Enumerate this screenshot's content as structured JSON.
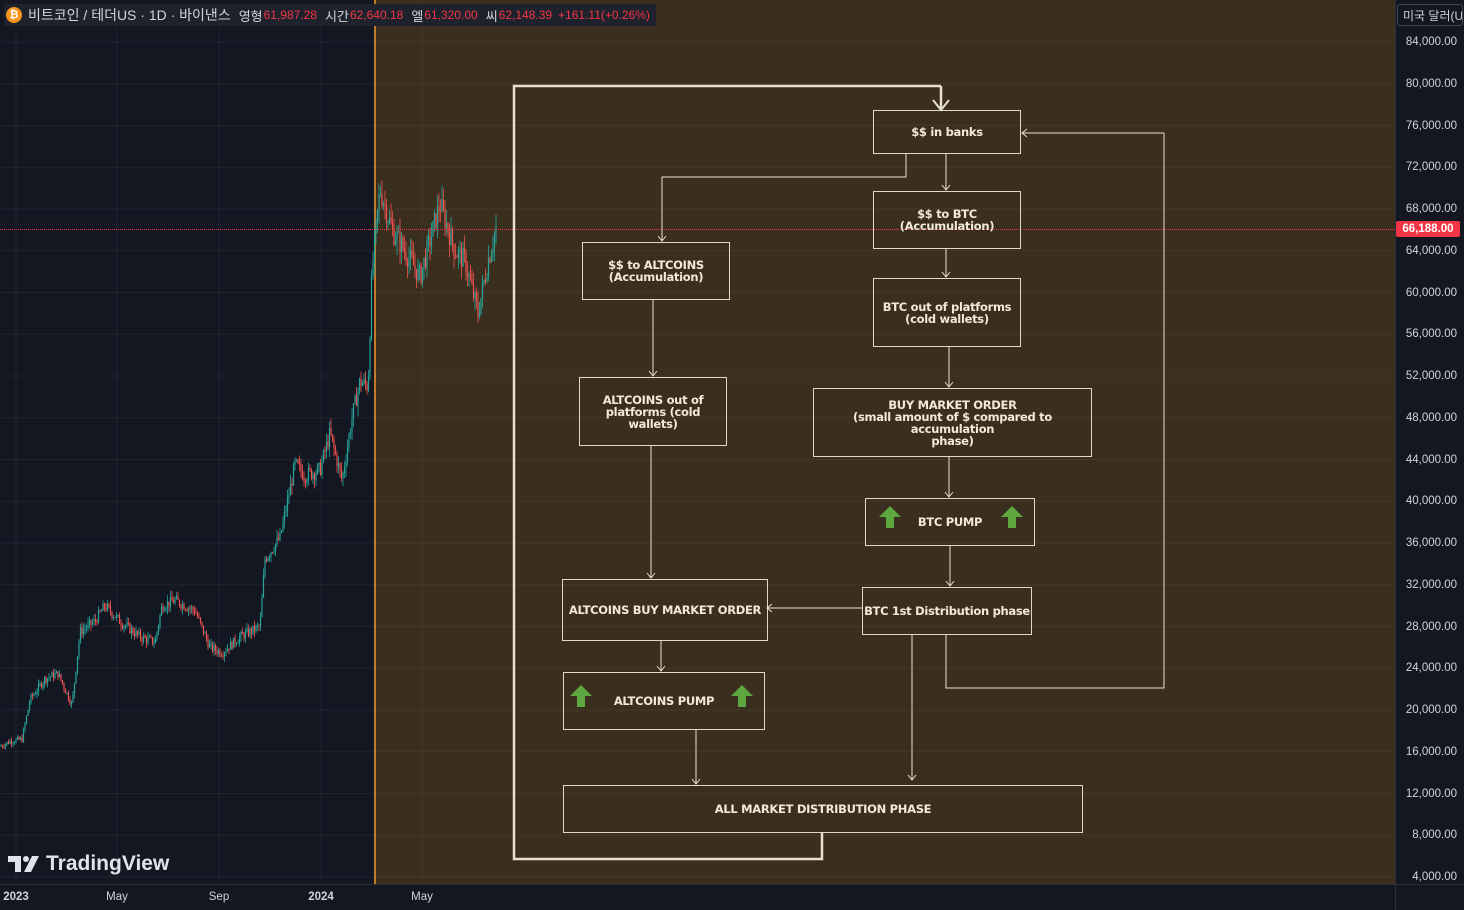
{
  "legend": {
    "symbol": "비트코인 / 테더US · 1D · 바이낸스",
    "open_label": "영형",
    "open": "61,987.28",
    "high_label": "시간",
    "high": "62,640.18",
    "low_label": "엘",
    "low": "61,320.00",
    "close_label": "씨",
    "close": "62,148.39",
    "change": "+161.11(+0.26%)"
  },
  "currency_selector": "미국 달러(USD)",
  "current_price": "66,188.00",
  "price_axis": [
    "84,000.00",
    "80,000.00",
    "76,000.00",
    "72,000.00",
    "68,000.00",
    "64,000.00",
    "60,000.00",
    "56,000.00",
    "52,000.00",
    "48,000.00",
    "44,000.00",
    "40,000.00",
    "36,000.00",
    "32,000.00",
    "28,000.00",
    "24,000.00",
    "20,000.00",
    "16,000.00",
    "12,000.00",
    "8,000.00",
    "4,000.00"
  ],
  "time_axis": [
    "2023",
    "May",
    "Sep",
    "2024",
    "May"
  ],
  "watermark": "TradingView",
  "colors": {
    "up": "#26a69a",
    "down": "#ef5350",
    "highlight": "#3a2e1f",
    "price_line": "#f23645",
    "pump_arrow": "#5ea63f"
  },
  "flow": {
    "banks": "$$ in banks",
    "to_btc": "$$ to BTC\n(Accumulation)",
    "btc_out": "BTC out of platforms\n(cold wallets)",
    "buy_order": "BUY MARKET ORDER\n(small amount of $ compared to accumulation\nphase)",
    "btc_pump": "BTC PUMP",
    "btc_dist": "BTC 1st Distribution phase",
    "to_alt": "$$ to ALTCOINS\n(Accumulation)",
    "alt_out": "ALTCOINS out of\nplatforms (cold wallets)",
    "alt_buy": "ALTCOINS BUY MARKET ORDER",
    "alt_pump": "ALTCOINS PUMP",
    "all_dist": "ALL MARKET DISTRIBUTION PHASE"
  }
}
